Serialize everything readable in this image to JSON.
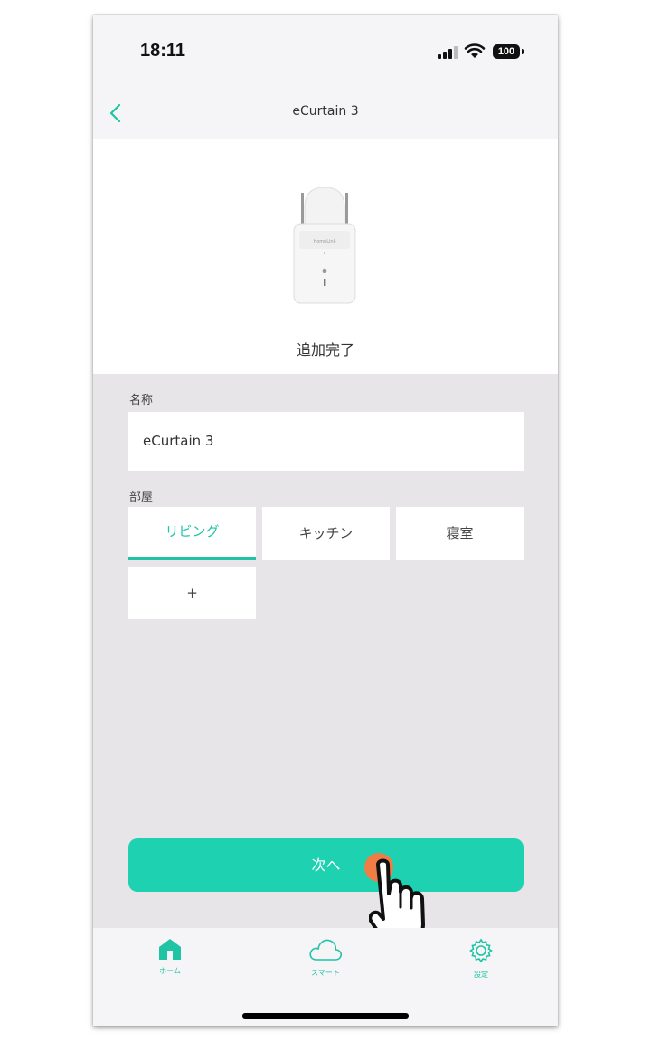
{
  "status": {
    "time": "18:11",
    "battery": "100"
  },
  "nav": {
    "title": "eCurtain 3"
  },
  "hero": {
    "device_brand": "HomeLink",
    "done_text": "追加完了"
  },
  "form": {
    "name_label": "名称",
    "name_value": "eCurtain 3",
    "room_label": "部屋",
    "rooms": [
      "リビング",
      "キッチン",
      "寝室",
      "+"
    ],
    "selected_room": "リビング"
  },
  "buttons": {
    "next": "次へ"
  },
  "tabbar": {
    "items": [
      {
        "label": "ホーム",
        "icon": "home-icon",
        "active": true
      },
      {
        "label": "スマート",
        "icon": "cloud-icon",
        "active": false
      },
      {
        "label": "設定",
        "icon": "gear-icon",
        "active": false
      }
    ]
  },
  "colors": {
    "accent": "#1dd1b1",
    "accent_text": "#1fc4a5",
    "background": "#e7e5e8",
    "tap_indicator": "#ef7d45"
  }
}
